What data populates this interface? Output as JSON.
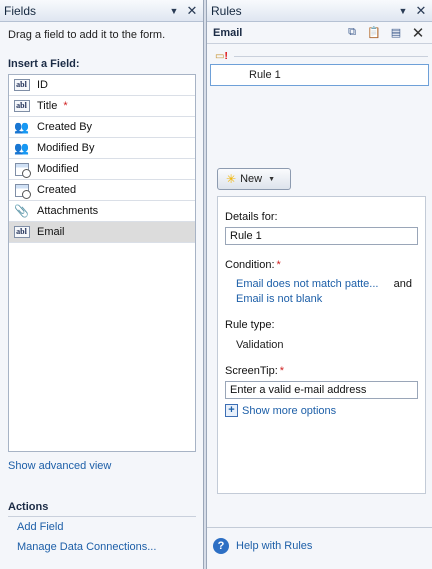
{
  "fields_pane": {
    "title": "Fields",
    "hint": "Drag a field to add it to the form.",
    "insert_label": "Insert a Field:",
    "items": [
      {
        "label": "ID",
        "icon": "text-field-icon",
        "required": false
      },
      {
        "label": "Title",
        "icon": "text-field-icon",
        "required": true
      },
      {
        "label": "Created By",
        "icon": "people-icon",
        "required": false
      },
      {
        "label": "Modified By",
        "icon": "people-icon",
        "required": false
      },
      {
        "label": "Modified",
        "icon": "date-time-icon",
        "required": false
      },
      {
        "label": "Created",
        "icon": "date-time-icon",
        "required": false
      },
      {
        "label": "Attachments",
        "icon": "paperclip-icon",
        "required": false
      },
      {
        "label": "Email",
        "icon": "text-field-icon",
        "required": false,
        "selected": true
      }
    ],
    "required_marker": "*",
    "advanced_link": "Show advanced view",
    "actions_title": "Actions",
    "add_field": "Add Field",
    "manage_connections": "Manage Data Connections..."
  },
  "rules_pane": {
    "title": "Rules",
    "control_name": "Email",
    "rule_name": "Rule 1",
    "new_button": "New",
    "details_label": "Details for:",
    "details_value": "Rule 1",
    "condition_label": "Condition:",
    "required_marker": "*",
    "condition_1": "Email does not match patte...",
    "condition_and": "and",
    "condition_2": "Email is not blank",
    "rule_type_label": "Rule type:",
    "rule_type_value": "Validation",
    "screentip_label": "ScreenTip:",
    "screentip_value": "Enter a valid e-mail address",
    "show_more": "Show more options",
    "help_link": "Help with Rules"
  }
}
